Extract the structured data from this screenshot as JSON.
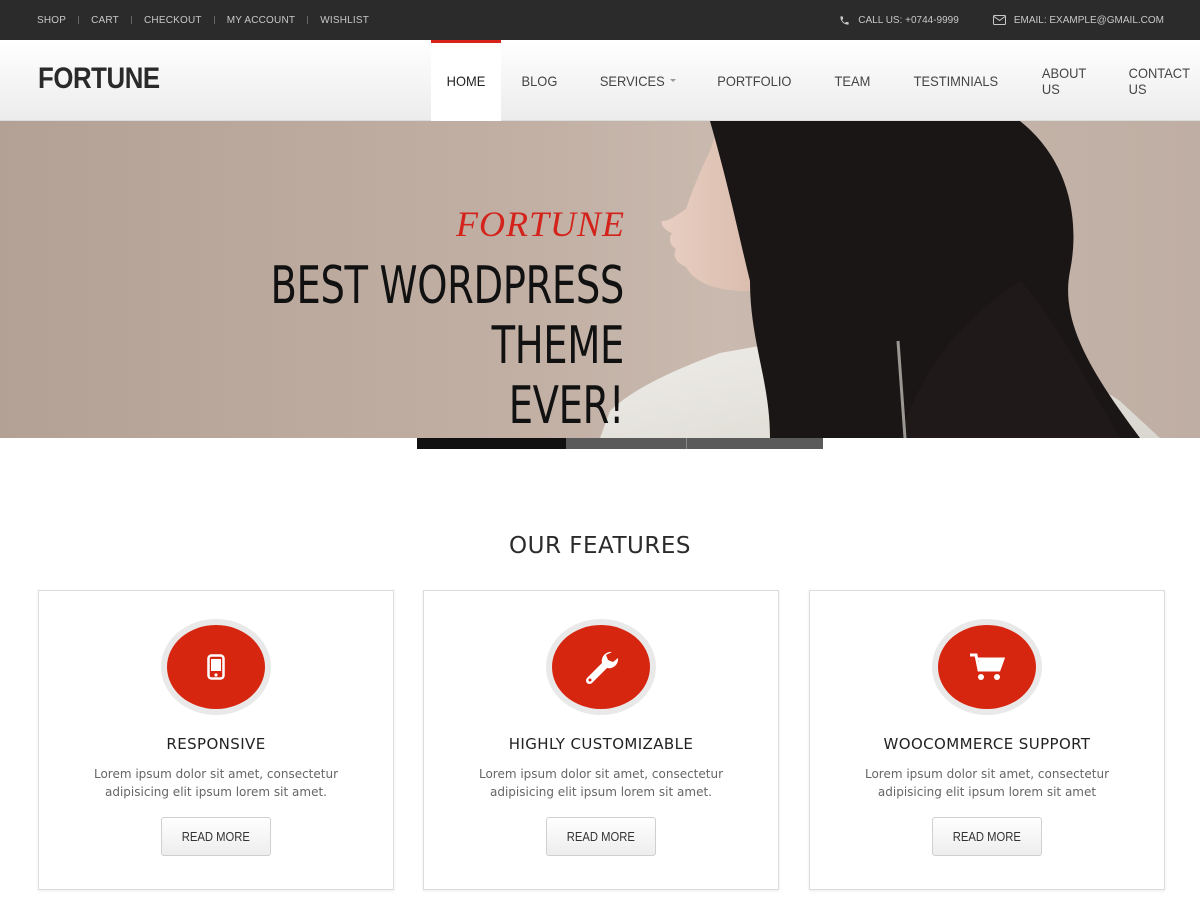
{
  "topbar": {
    "links": [
      "SHOP",
      "CART",
      "CHECKOUT",
      "MY ACCOUNT",
      "WISHLIST"
    ],
    "phone": "CALL US: +0744-9999",
    "email": "EMAIL: EXAMPLE@GMAIL.COM"
  },
  "header": {
    "logo": "FORTUNE",
    "nav": [
      {
        "label": "HOME",
        "active": true
      },
      {
        "label": "BLOG"
      },
      {
        "label": "SERVICES",
        "dropdown": true
      },
      {
        "label": "PORTFOLIO"
      },
      {
        "label": "TEAM"
      },
      {
        "label": "TESTIMNIALS"
      },
      {
        "label": "ABOUT US"
      },
      {
        "label": "CONTACT US"
      }
    ]
  },
  "hero": {
    "subtitle": "FORTUNE",
    "title_line1": "BEST WORDPRESS THEME",
    "title_line2": "EVER!",
    "slides_count": 3,
    "active_slide": 1
  },
  "features": {
    "title": "OUR FEATURES",
    "cards": [
      {
        "icon": "mobile-icon",
        "title": "RESPONSIVE",
        "text": "Lorem ipsum dolor sit amet, consectetur adipisicing elit ipsum lorem sit amet.",
        "button": "READ MORE"
      },
      {
        "icon": "wrench-icon",
        "title": "HIGHLY CUSTOMIZABLE",
        "text": "Lorem ipsum dolor sit amet, consectetur adipisicing elit ipsum lorem sit amet.",
        "button": "READ MORE"
      },
      {
        "icon": "cart-icon",
        "title": "WOOCOMMERCE SUPPORT",
        "text": "Lorem ipsum dolor sit amet, consectetur adipisicing elit ipsum lorem sit amet",
        "button": "READ MORE"
      }
    ]
  },
  "colors": {
    "accent": "#d6260f",
    "topbar": "#2b2b2b"
  }
}
